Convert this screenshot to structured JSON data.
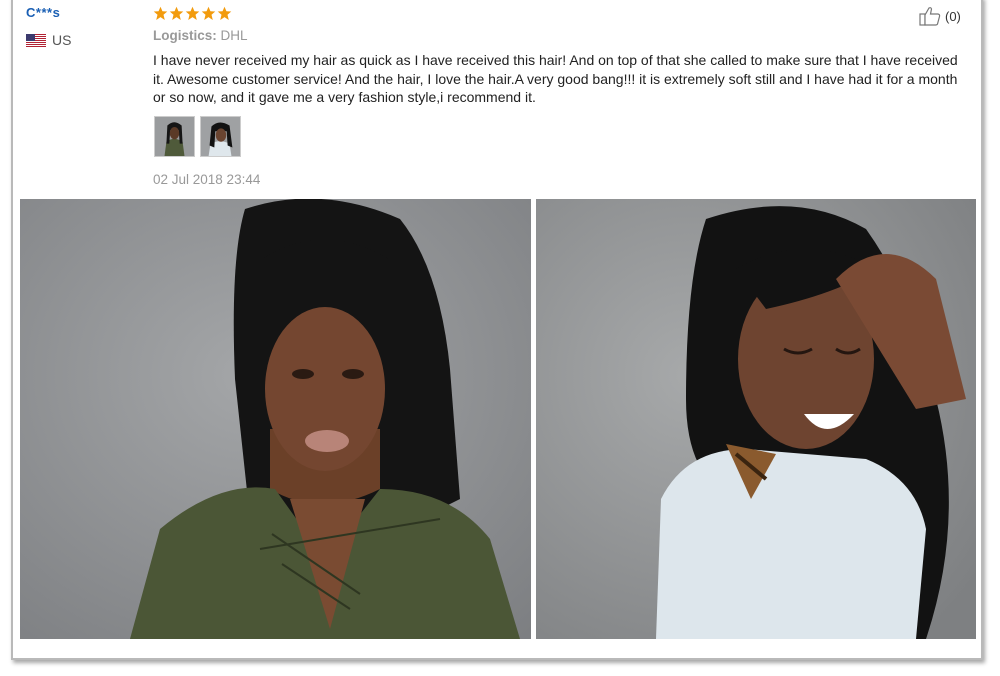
{
  "review": {
    "reviewer": "C***s",
    "country": "US",
    "rating": 5,
    "logistics_label": "Logistics:",
    "logistics_value": "DHL",
    "helpful_count": "(0)",
    "text": "I have never received my hair as quick as I have received this hair! And on top of that she called to make sure that I have received it. Awesome customer service! And the hair, I love the hair.A very good bang!!! it is extremely soft still and I have had it for a month or so now, and it gave me a very fashion style,i recommend it.",
    "date": "02 Jul 2018 23:44"
  },
  "icons": {
    "star": "star-icon",
    "flag": "us-flag-icon",
    "helpful": "thumbs-up-icon"
  },
  "colors": {
    "reviewer_name": "#1a5fb4",
    "star": "#f29b0d",
    "muted_text": "#999999"
  }
}
